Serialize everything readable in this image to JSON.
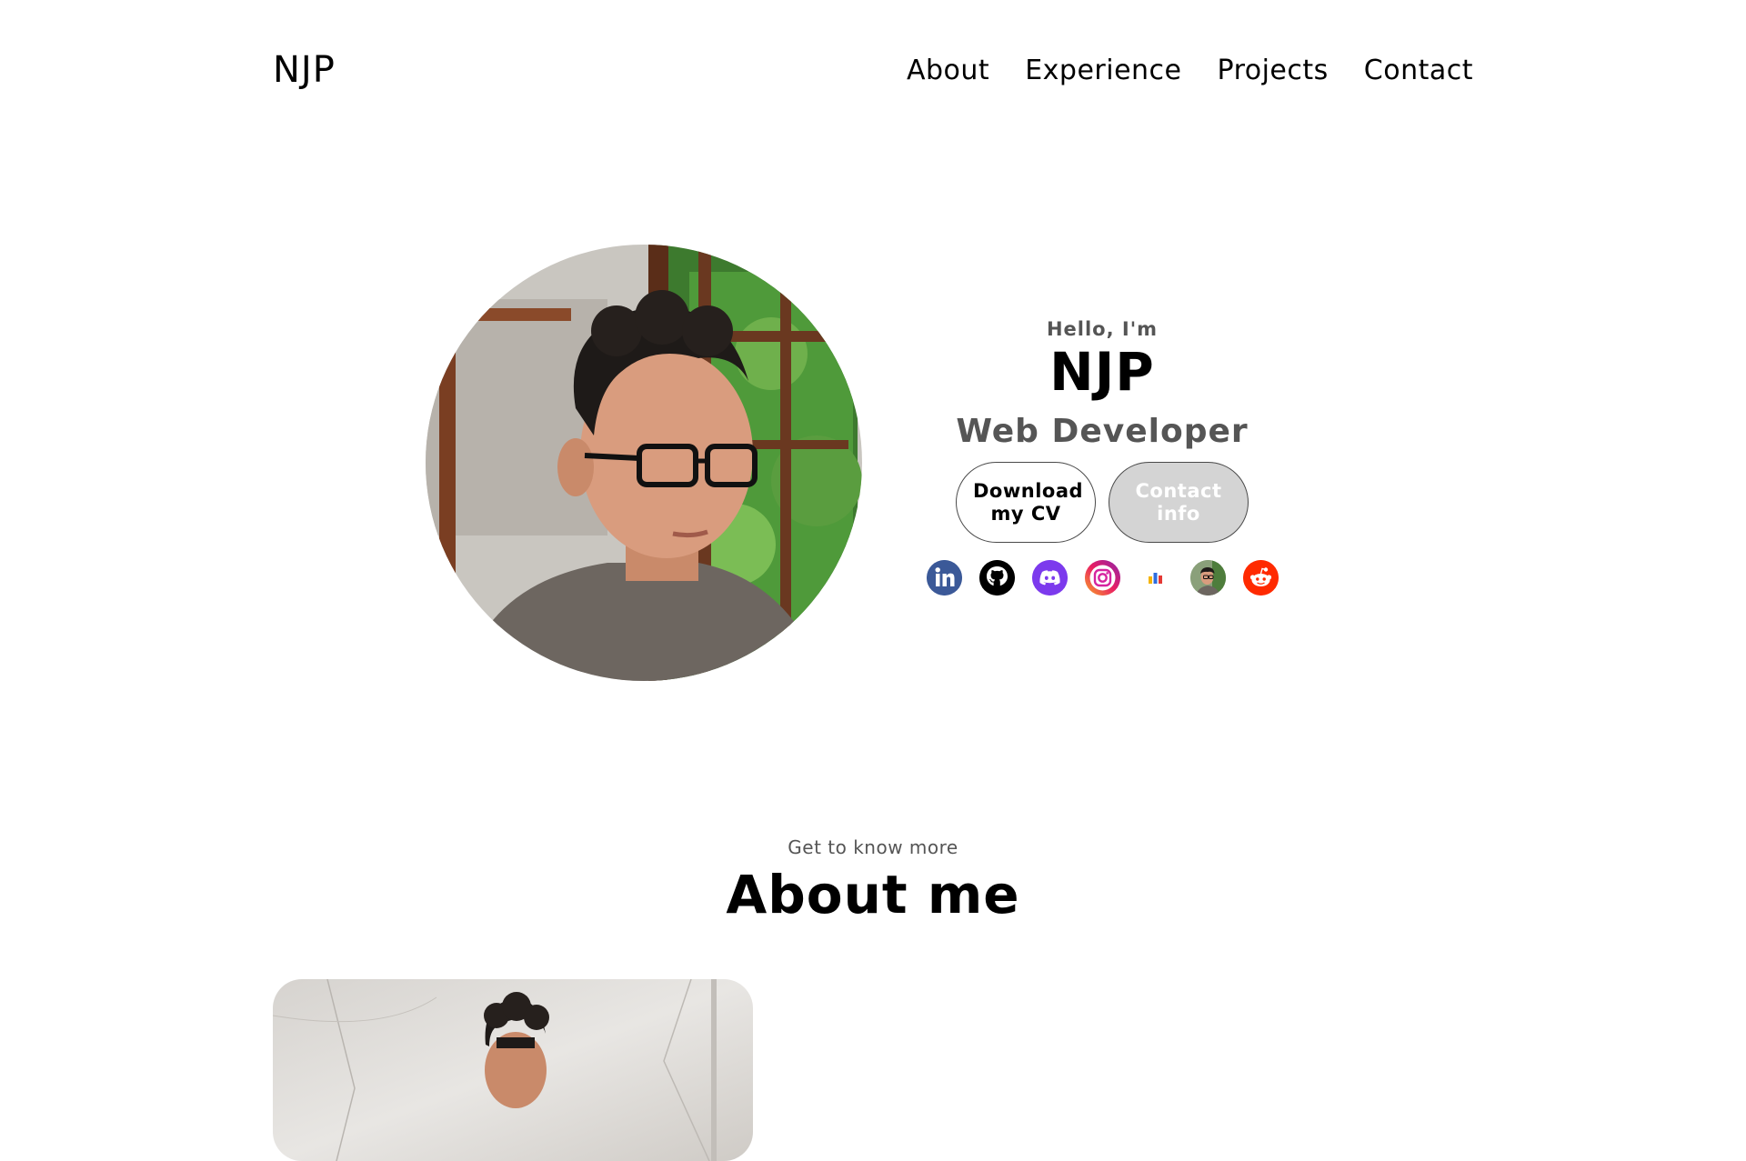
{
  "nav": {
    "logo": "NJP",
    "links": [
      {
        "label": "About"
      },
      {
        "label": "Experience"
      },
      {
        "label": "Projects"
      },
      {
        "label": "Contact"
      }
    ]
  },
  "hero": {
    "greeting": "Hello, I'm",
    "name": "NJP",
    "role": "Web Developer",
    "buttons": {
      "cv": "Download my CV",
      "contact": "Contact info"
    },
    "socials": [
      {
        "icon": "linkedin-icon",
        "color": "#3b5998"
      },
      {
        "icon": "github-icon",
        "color": "#000000"
      },
      {
        "icon": "discord-icon",
        "color": "#7c3aed"
      },
      {
        "icon": "instagram-icon",
        "color": "#d6249f"
      },
      {
        "icon": "stats-icon",
        "color": "#f5b400"
      },
      {
        "icon": "profile-avatar-icon",
        "color": "#6b8e5a"
      },
      {
        "icon": "reddit-icon",
        "color": "#ff2a00"
      }
    ]
  },
  "about": {
    "subtitle": "Get to know more",
    "title": "About me"
  }
}
